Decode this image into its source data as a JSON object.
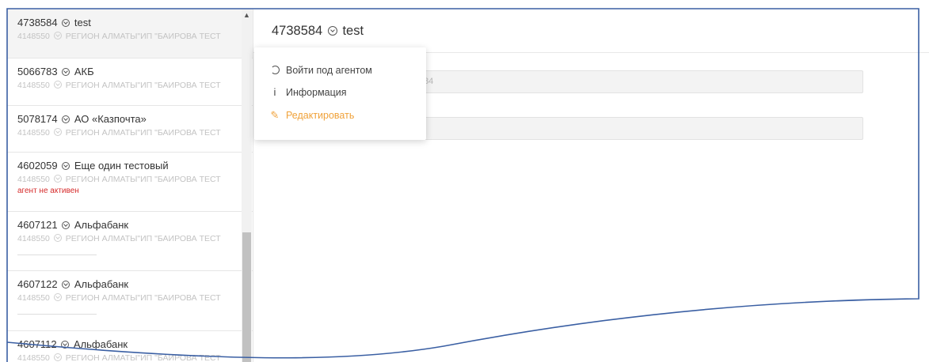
{
  "agents": [
    {
      "title": "4738584 ⊙ test",
      "id": "4738584",
      "name": "test",
      "sub_id": "4148550",
      "sub_text": "РЕГИОН АЛМАТЫ\"ИП \"БАИРОВА ТЕСТ",
      "status": "",
      "active": true
    },
    {
      "title": "5066783 ⊙ АКБ",
      "id": "5066783",
      "name": "АКБ",
      "sub_id": "4148550",
      "sub_text": "РЕГИОН АЛМАТЫ\"ИП \"БАИРОВА ТЕСТ",
      "status": ""
    },
    {
      "title": "5078174 ⊙ АО «Казпочта»",
      "id": "5078174",
      "name": "АО «Казпочта»",
      "sub_id": "4148550",
      "sub_text": "РЕГИОН АЛМАТЫ\"ИП \"БАИРОВА ТЕСТ",
      "status": ""
    },
    {
      "title": "4602059 ⊙ Еще один тестовый",
      "id": "4602059",
      "name": "Еще один тестовый",
      "sub_id": "4148550",
      "sub_text": "РЕГИОН АЛМАТЫ\"ИП \"БАИРОВА ТЕСТ",
      "status": "агент не активен"
    },
    {
      "title": "4607121 ⊙ Альфабанк",
      "id": "4607121",
      "name": "Альфабанк",
      "sub_id": "4148550",
      "sub_text": "РЕГИОН АЛМАТЫ\"ИП \"БАИРОВА ТЕСТ",
      "status": ""
    },
    {
      "title": "4607122 ⊙ Альфабанк",
      "id": "4607122",
      "name": "Альфабанк",
      "sub_id": "4148550",
      "sub_text": "РЕГИОН АЛМАТЫ\"ИП \"БАИРОВА ТЕСТ",
      "status": ""
    },
    {
      "title": "4607112 ⊙ Альфабанк",
      "id": "4607112",
      "name": "Альфабанк",
      "sub_id": "4148550",
      "sub_text": "РЕГИОН АЛМАТЫ\"ИП \"БАИРОВА ТЕСТ",
      "status": ""
    }
  ],
  "main": {
    "title_id": "4738584",
    "title_name": "test",
    "field1_value": "84",
    "field2_value": ""
  },
  "menu": {
    "items": [
      {
        "label": "Войти под агентом",
        "icon": "enter-icon"
      },
      {
        "label": "Информация",
        "icon": "info-icon"
      },
      {
        "label": "Редактировать",
        "icon": "pencil-icon"
      }
    ]
  },
  "colors": {
    "accent_edit": "#f0a23a",
    "status_inactive": "#d62b2b",
    "outline": "#3a5fa3"
  }
}
